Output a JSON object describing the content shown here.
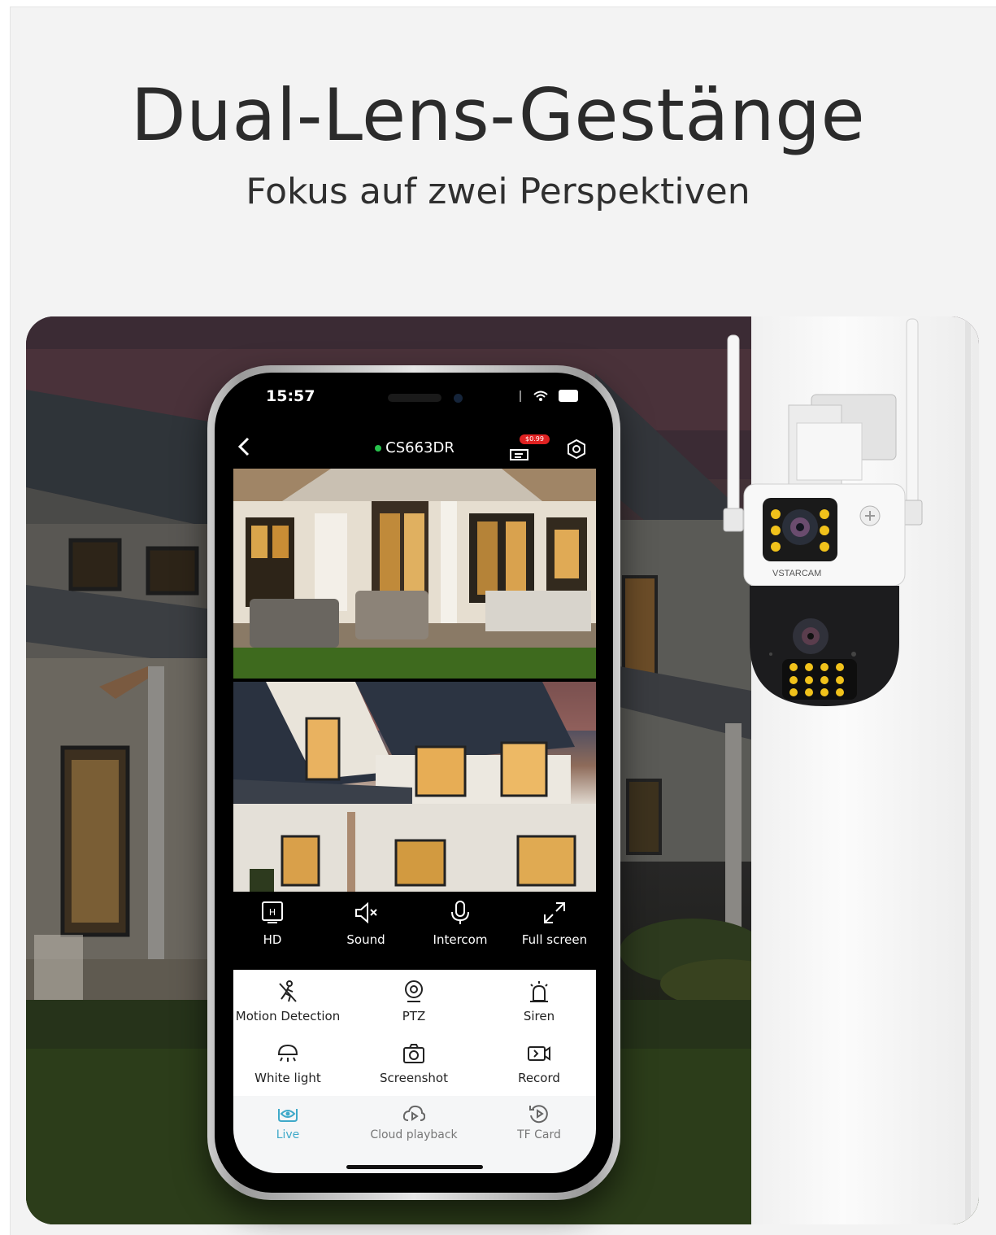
{
  "banner": {
    "title": "Dual-Lens-Gestänge",
    "subtitle": "Fokus auf zwei Perspektiven"
  },
  "phone": {
    "status_time": "15:57",
    "device_name": "CS663DR",
    "device_online": true,
    "price_badge": "$0.99",
    "controls": [
      {
        "label": "HD",
        "icon": "hd-icon"
      },
      {
        "label": "Sound",
        "icon": "speaker-muted-icon"
      },
      {
        "label": "Intercom",
        "icon": "microphone-icon"
      },
      {
        "label": "Full screen",
        "icon": "expand-icon"
      }
    ],
    "functions": [
      {
        "label": "Motion Detection",
        "icon": "motion-detection-icon"
      },
      {
        "label": "PTZ",
        "icon": "ptz-camera-icon"
      },
      {
        "label": "Siren",
        "icon": "siren-icon"
      },
      {
        "label": "White light",
        "icon": "lamp-icon"
      },
      {
        "label": "Screenshot",
        "icon": "camera-icon"
      },
      {
        "label": "Record",
        "icon": "video-record-icon"
      }
    ],
    "tabs": [
      {
        "label": "Live",
        "icon": "live-eye-icon",
        "active": true
      },
      {
        "label": "Cloud playback",
        "icon": "cloud-playback-icon",
        "active": false
      },
      {
        "label": "TF Card",
        "icon": "tf-card-replay-icon",
        "active": false
      }
    ],
    "accent_color": "#3fa9c9"
  },
  "camera_product": {
    "brand_label": "VSTARCAM"
  }
}
